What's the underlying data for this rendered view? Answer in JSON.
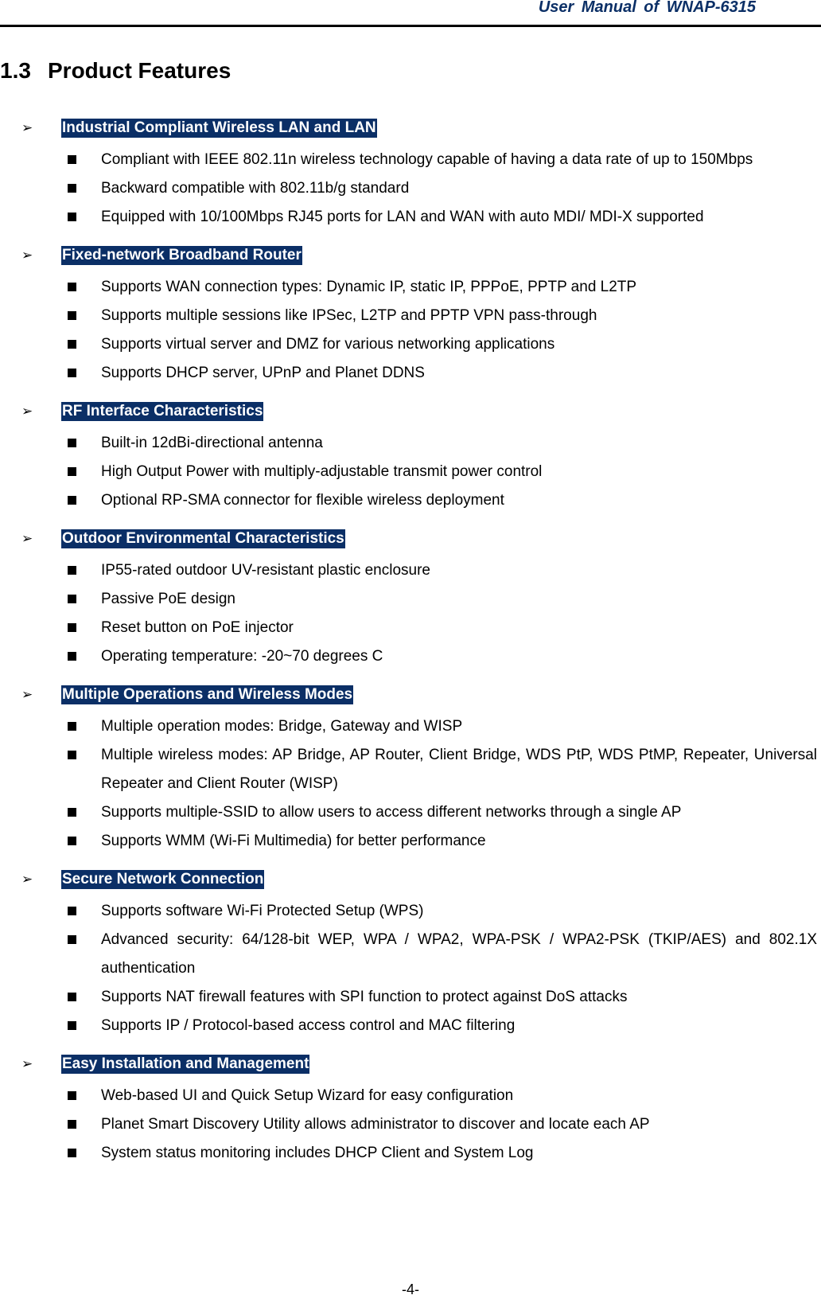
{
  "header": {
    "title": "User  Manual  of  WNAP-6315"
  },
  "section": {
    "number": "1.3",
    "title": "Product Features"
  },
  "groups": [
    {
      "title": "Industrial Compliant Wireless LAN and LAN",
      "items": [
        "Compliant with IEEE 802.11n wireless technology capable of having a data rate of up to 150Mbps",
        "Backward compatible with 802.11b/g standard",
        "Equipped with 10/100Mbps RJ45 ports for LAN and WAN with auto MDI/ MDI-X supported"
      ]
    },
    {
      "title": "Fixed-network Broadband Router",
      "items": [
        "Supports WAN connection types: Dynamic IP, static IP, PPPoE, PPTP and L2TP",
        "Supports multiple sessions like IPSec, L2TP and PPTP VPN pass-through",
        "Supports virtual server and DMZ for various networking applications",
        "Supports DHCP server, UPnP and Planet DDNS"
      ]
    },
    {
      "title": "RF Interface Characteristics",
      "items": [
        "Built-in 12dBi-directional antenna",
        "High Output Power with multiply-adjustable transmit power control",
        "Optional RP-SMA connector for flexible wireless deployment"
      ]
    },
    {
      "title": "Outdoor Environmental Characteristics",
      "items": [
        "IP55-rated outdoor UV-resistant plastic enclosure",
        "Passive PoE design",
        "Reset button on PoE injector",
        "Operating temperature: -20~70 degrees C"
      ]
    },
    {
      "title": "Multiple Operations and Wireless Modes",
      "items": [
        "Multiple operation modes: Bridge, Gateway and WISP",
        "Multiple wireless modes: AP Bridge, AP Router, Client Bridge, WDS PtP, WDS PtMP, Repeater, Universal Repeater and Client Router (WISP)",
        "Supports multiple-SSID to allow users to access different networks through a single AP",
        "Supports WMM (Wi-Fi Multimedia) for better performance"
      ]
    },
    {
      "title": "Secure Network Connection",
      "items": [
        "Supports software Wi-Fi Protected Setup (WPS)",
        "Advanced security: 64/128-bit WEP, WPA / WPA2, WPA-PSK / WPA2-PSK (TKIP/AES) and 802.1X authentication",
        "Supports NAT firewall features with SPI function to protect against DoS attacks",
        "Supports IP / Protocol-based access control and MAC filtering"
      ]
    },
    {
      "title": "Easy Installation and Management",
      "items": [
        "Web-based UI and Quick Setup Wizard for easy configuration",
        "Planet Smart Discovery Utility allows administrator to discover and locate each AP",
        "System status monitoring includes DHCP Client and System Log"
      ]
    }
  ],
  "footer": {
    "page_number": "-4-"
  },
  "colors": {
    "heading_highlight": "#0b2f66",
    "header_text": "#0b2f66"
  }
}
